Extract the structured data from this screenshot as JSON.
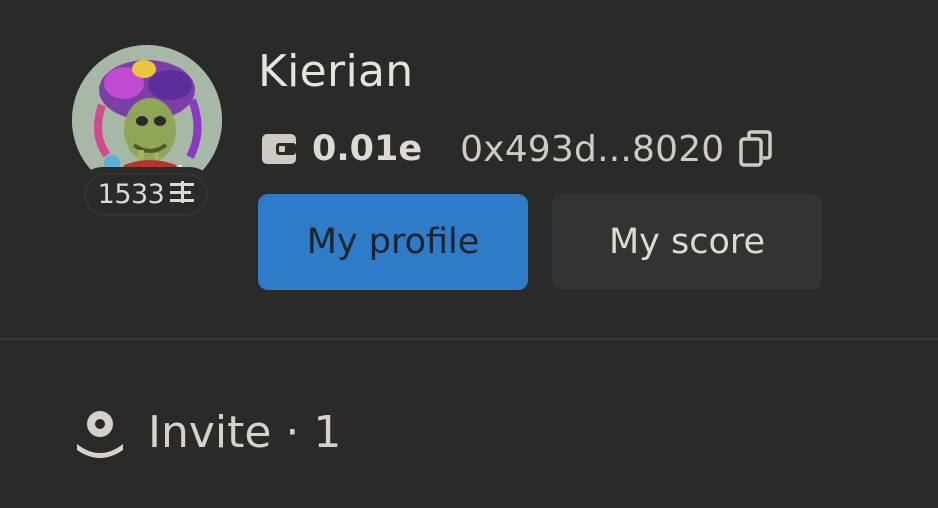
{
  "profile": {
    "username": "Kierian",
    "score": "1533",
    "balance": "0.01e",
    "address": "0x493d...8020"
  },
  "icons": {
    "avatar": "nft-avatar-image",
    "score": "score-bars-icon",
    "wallet": "wallet-icon",
    "copy": "copy-icon",
    "invite": "invite-person-icon"
  },
  "actions": {
    "my_profile": "My profile",
    "my_score": "My score"
  },
  "invite": {
    "label": "Invite · 1"
  },
  "colors": {
    "background": "#2a2a28",
    "primary_button": "#2e7bc7",
    "secondary_button": "#333331",
    "text": "#e6e3dc"
  }
}
